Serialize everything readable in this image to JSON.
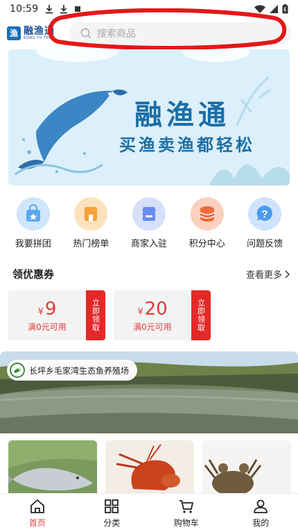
{
  "status_bar": {
    "time": "10:59",
    "left_icons": [
      "download-icon",
      "download-icon",
      "notification-icon"
    ],
    "right_icons": [
      "wifi-icon",
      "signal-icon",
      "battery-icon"
    ]
  },
  "header": {
    "logo": {
      "badge_text": "渔",
      "cn_text": "融渔通",
      "en_text": "RONG YU TONG"
    },
    "search": {
      "placeholder": "搜索商品",
      "icon": "search-icon"
    }
  },
  "banner": {
    "title": "融渔通",
    "subtitle": "买渔卖渔都轻松",
    "colors": {
      "primary": "#1d6ea6",
      "background": "#dff2fb"
    }
  },
  "quick_menu": [
    {
      "label": "我要拼团",
      "icon": "group-buy-bag-icon",
      "color": "#5aa9f0"
    },
    {
      "label": "热门榜单",
      "icon": "hot-list-store-icon",
      "color": "#f6a23a"
    },
    {
      "label": "商家入驻",
      "icon": "merchant-store-icon",
      "color": "#6a8cf0"
    },
    {
      "label": "积分中心",
      "icon": "points-coins-icon",
      "color": "#f26a3a"
    },
    {
      "label": "问题反馈",
      "icon": "feedback-question-icon",
      "color": "#4c9af2"
    }
  ],
  "coupon_section": {
    "title": "领优惠券",
    "more_label": "查看更多",
    "more_icon": "chevron-right-icon",
    "coupons": [
      {
        "currency": "¥",
        "amount": "9",
        "condition": "满0元可用",
        "action": "立即领取"
      },
      {
        "currency": "¥",
        "amount": "20",
        "condition": "满0元可用",
        "action": "立即领取"
      }
    ],
    "accent_color": "#e52828"
  },
  "farm": {
    "name": "长坪乡毛家湾生态鱼养殖场",
    "avatar_icon": "farm-logo-icon"
  },
  "products": [
    {
      "image": "fish-image"
    },
    {
      "image": "crayfish-image"
    },
    {
      "image": "crab-image"
    }
  ],
  "tab_bar": {
    "active_color": "#e23b3b",
    "tabs": [
      {
        "label": "首页",
        "icon": "home-icon",
        "active": true
      },
      {
        "label": "分类",
        "icon": "category-grid-icon",
        "active": false
      },
      {
        "label": "购物车",
        "icon": "cart-icon",
        "active": false
      },
      {
        "label": "我的",
        "icon": "profile-icon",
        "active": false
      }
    ]
  }
}
